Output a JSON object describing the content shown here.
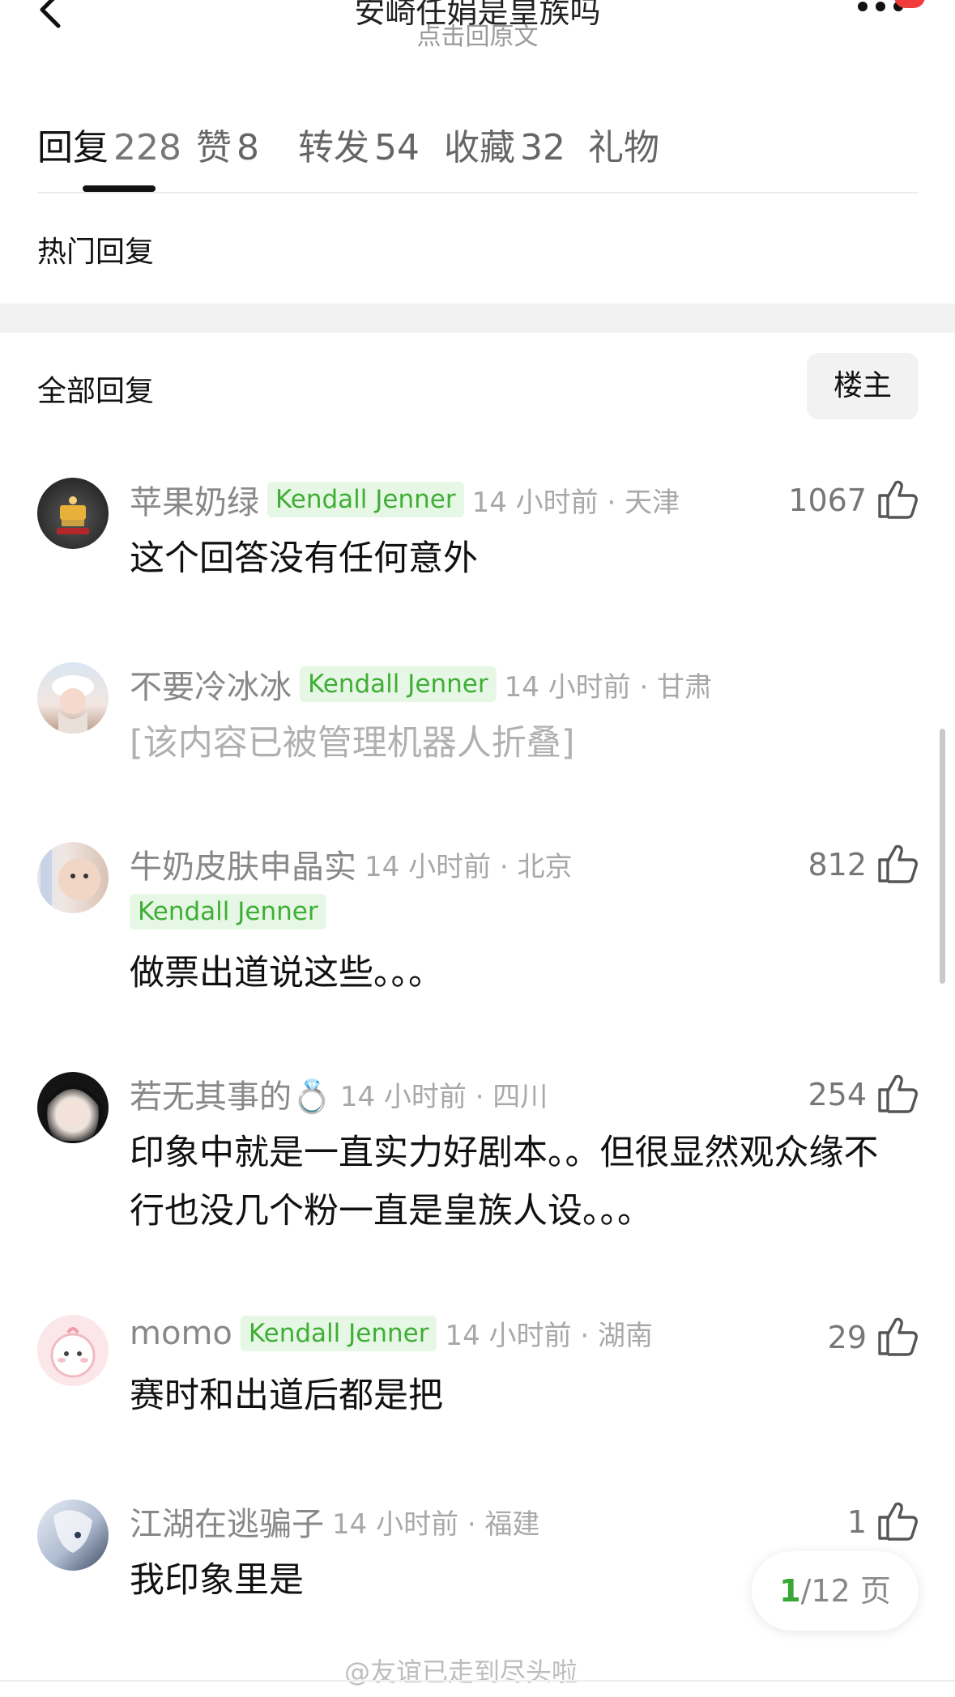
{
  "header": {
    "title": "安崎任娟是皇族吗",
    "subtitle": "点击回原文"
  },
  "tabs": [
    {
      "label": "回复",
      "count": "228"
    },
    {
      "label": "赞",
      "count": "8"
    },
    {
      "label": "转发",
      "count": "54"
    },
    {
      "label": "收藏",
      "count": "32"
    },
    {
      "label": "礼物",
      "count": ""
    }
  ],
  "sections": {
    "hot": "热门回复",
    "all": "全部回复",
    "owner_filter": "楼主"
  },
  "comments": [
    {
      "user": "苹果奶绿",
      "badge": "Kendall Jenner",
      "time": "14 小时前 · 天津",
      "likes": "1067",
      "text": "这个回答没有任何意外"
    },
    {
      "user": "不要冷冰冰",
      "badge": "Kendall Jenner",
      "time": "14 小时前 · 甘肃",
      "likes": "",
      "text": "[该内容已被管理机器人折叠]"
    },
    {
      "user": "牛奶皮肤申晶实",
      "badge": "Kendall Jenner",
      "time": "14 小时前 · 北京",
      "likes": "812",
      "text": "做票出道说这些。。。"
    },
    {
      "user": "若无其事的💍",
      "badge": "",
      "time": "14 小时前 · 四川",
      "likes": "254",
      "text": "印象中就是一直实力好剧本。。但很显然观众缘不行也没几个粉一直是皇族人设。。。"
    },
    {
      "user": "momo",
      "badge": "Kendall Jenner",
      "time": "14 小时前 · 湖南",
      "likes": "29",
      "text": "赛时和出道后都是把"
    },
    {
      "user": "江湖在逃骗子",
      "badge": "",
      "time": "14 小时前 · 福建",
      "likes": "1",
      "text": "我印象里是"
    }
  ],
  "pager": {
    "current": "1",
    "total": "/12 页"
  },
  "watermark": "@友谊已走到尽头啦",
  "colors": {
    "badge_green": "#3fae35",
    "badge_bg": "#e7f7e5",
    "pager_green": "#37a836"
  }
}
